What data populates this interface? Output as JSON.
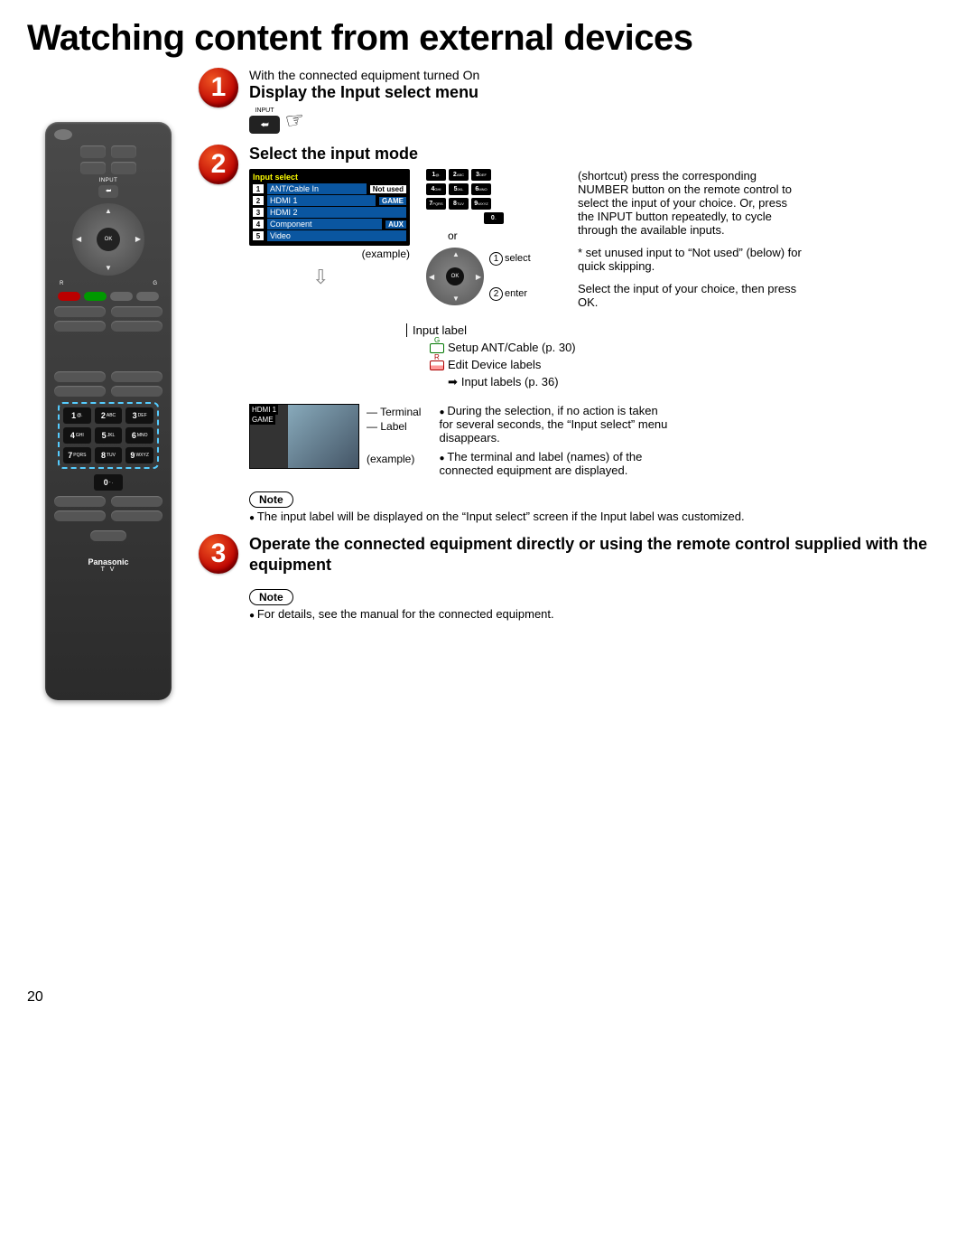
{
  "page_number": "20",
  "title": "Watching content from external devices",
  "remote": {
    "input_label": "INPUT",
    "ok_label": "OK",
    "color_left": "R",
    "color_right": "G",
    "keys": [
      {
        "n": "1",
        "s": "@."
      },
      {
        "n": "2",
        "s": "ABC"
      },
      {
        "n": "3",
        "s": "DEF"
      },
      {
        "n": "4",
        "s": "GHI"
      },
      {
        "n": "5",
        "s": "JKL"
      },
      {
        "n": "6",
        "s": "MNO"
      },
      {
        "n": "7",
        "s": "PQRS"
      },
      {
        "n": "8",
        "s": "TUV"
      },
      {
        "n": "9",
        "s": "WXYZ"
      }
    ],
    "zero": {
      "n": "0",
      "s": "- ."
    },
    "brand": "Panasonic",
    "brand_sub": "T V"
  },
  "step1": {
    "num": "1",
    "pre": "With the connected equipment turned On",
    "title": "Display the Input select menu",
    "btn_label": "INPUT"
  },
  "step2": {
    "num": "2",
    "title": "Select the input mode",
    "osd_header": "Input select",
    "osd_rows": [
      {
        "i": "1",
        "n": "ANT/Cable In",
        "tag": "Not used"
      },
      {
        "i": "2",
        "n": "HDMI 1",
        "tag": "GAME"
      },
      {
        "i": "3",
        "n": "HDMI 2",
        "tag": ""
      },
      {
        "i": "4",
        "n": "Component",
        "tag": "AUX"
      },
      {
        "i": "5",
        "n": "Video",
        "tag": ""
      }
    ],
    "example": "(example)",
    "or": "or",
    "select_lbl": "select",
    "enter_lbl": "enter",
    "shortcut_para": "(shortcut) press the corresponding NUMBER button on the remote control to select the input of your choice. Or, press the INPUT button repeatedly, to cycle through the available inputs.",
    "star_para": "set unused input to “Not used” (below) for quick skipping.",
    "select_para": "Select the input of your choice, then press OK.",
    "input_label_hdr": "Input label",
    "link_setup": "Setup ANT/Cable (p. 30)",
    "link_edit": "Edit Device labels",
    "link_labels": "Input labels (p. 36)",
    "thumb_terminal": "HDMI 1",
    "thumb_label": "GAME",
    "thumb_t": "Terminal",
    "thumb_l": "Label",
    "bullets2": [
      "During the selection, if no action is taken for several seconds, the “Input select” menu disappears.",
      "The terminal and label (names) of the connected equipment are displayed."
    ],
    "note_pill": "Note",
    "note_text": "The input label will be displayed on the “Input select” screen if the Input label was customized."
  },
  "step3": {
    "num": "3",
    "title": "Operate the connected equipment directly or using the remote control supplied with the equipment",
    "note_pill": "Note",
    "note_text": "For details, see the manual for the connected equipment."
  }
}
